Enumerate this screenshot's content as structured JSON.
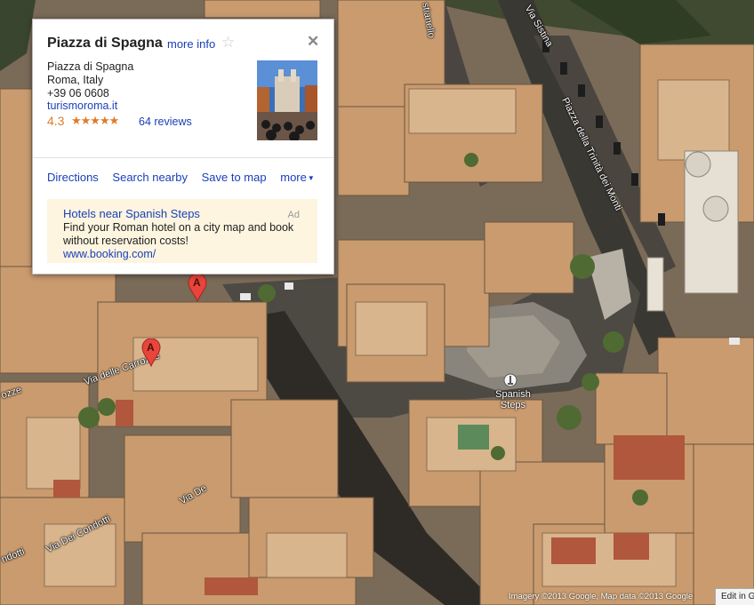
{
  "map": {
    "street_labels": [
      "Via delle Carrozze",
      "Via Dei Condotti",
      "Via De",
      "Piazza della Trinità dei Monti",
      "Via Sistina",
      "stianello",
      "ozze",
      "ndotti"
    ],
    "markers": [
      "A",
      "A"
    ],
    "poi": {
      "label_line1": "Spanish",
      "label_line2": "Steps",
      "icon": "monument-icon"
    },
    "attribution": "Imagery ©2013 Google, Map data ©2013 Google",
    "edit_link": "Edit in G"
  },
  "infowindow": {
    "title": "Piazza di Spagna",
    "more_info": "more info",
    "star_icon": "☆",
    "close_icon": "✕",
    "address_name": "Piazza di Spagna",
    "address_city": "Roma, Italy",
    "phone": "+39 06 0608",
    "website": "turismoroma.it",
    "rating": "4.3",
    "stars": "★★★★★",
    "reviews": "64 reviews",
    "actions": {
      "directions": "Directions",
      "search_nearby": "Search nearby",
      "save_to_map": "Save to map",
      "more": "more"
    },
    "ad": {
      "title": "Hotels near Spanish Steps",
      "label": "Ad",
      "text": "Find your Roman hotel on a city map and book without reservation costs!",
      "url": "www.booking.com/"
    }
  },
  "colors": {
    "link": "#1a3fb8",
    "rating": "#e07b28",
    "ad_background": "#fdf5e0",
    "marker": "#e8453c"
  }
}
